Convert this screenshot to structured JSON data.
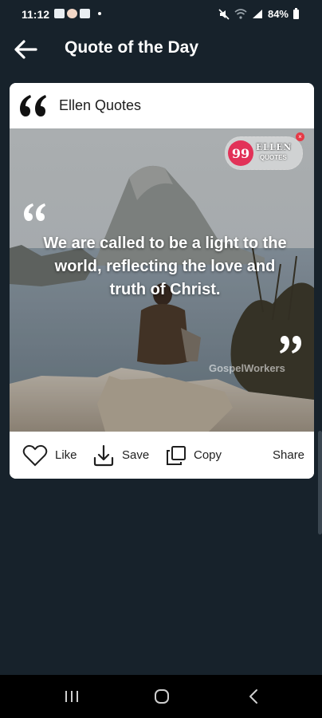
{
  "status_bar": {
    "time": "11:12",
    "battery": "84%",
    "icons": [
      "gallery-notification-icon",
      "avatar-notification-icon",
      "gallery-notification-icon",
      "dot-icon",
      "mute-icon",
      "wifi-icon",
      "signal-icon",
      "battery-icon"
    ]
  },
  "header": {
    "title": "Quote of the Day",
    "back_icon": "arrow-left-icon"
  },
  "card": {
    "source_name": "Ellen Quotes",
    "source_icon": "quote-marks-icon",
    "quote": "We are called to be a light to the world, reflecting the love and truth of Christ.",
    "watermark": "GospelWorkers",
    "brand": {
      "mark": "99",
      "name": "ELLEN",
      "sub": "QUOTES",
      "close": "×"
    },
    "actions": [
      {
        "label": "Like",
        "icon": "heart-icon"
      },
      {
        "label": "Save",
        "icon": "download-icon"
      },
      {
        "label": "Copy",
        "icon": "copy-icon"
      },
      {
        "label": "Share",
        "icon": "share-icon"
      }
    ]
  },
  "colors": {
    "background": "#17222b",
    "card": "#ffffff",
    "brand_accent": "#e23258"
  },
  "nav": {
    "icons": [
      "recents-icon",
      "home-icon",
      "back-icon"
    ]
  }
}
